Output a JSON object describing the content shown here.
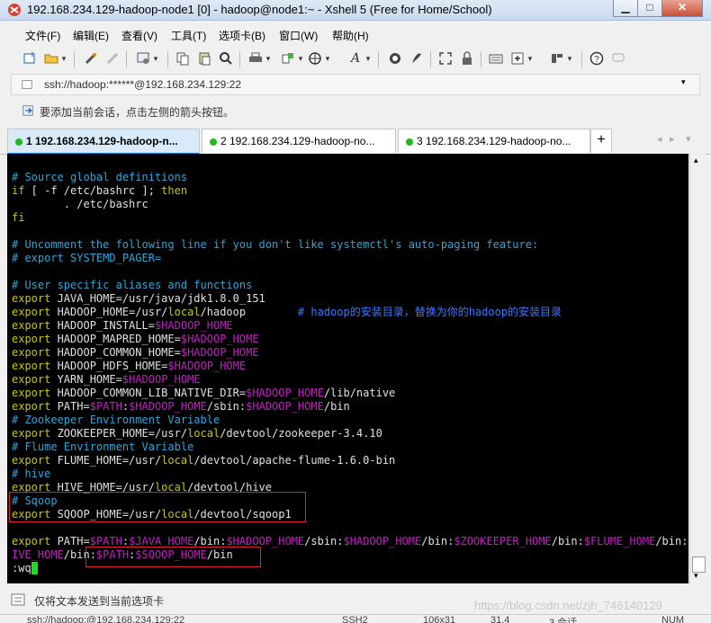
{
  "window": {
    "title": "192.168.234.129-hadoop-node1 [0] - hadoop@node1:~ - Xshell 5 (Free for Home/School)"
  },
  "menu": [
    "文件(F)",
    "编辑(E)",
    "查看(V)",
    "工具(T)",
    "选项卡(B)",
    "窗口(W)",
    "帮助(H)"
  ],
  "address": {
    "value": "ssh://hadoop:******@192.168.234.129:22"
  },
  "hint": {
    "text": "要添加当前会话，点击左侧的箭头按钮。"
  },
  "tabs": [
    {
      "num": "1",
      "label": "192.168.234.129-hadoop-node1",
      "display": "1 192.168.234.129-hadoop-n..."
    },
    {
      "num": "2",
      "display": "2 192.168.234.129-hadoop-no..."
    },
    {
      "num": "3",
      "display": "3 192.168.234.129-hadoop-no..."
    }
  ],
  "terminal": {
    "lines": [
      [
        [
          "# Source global definitions",
          "c"
        ]
      ],
      [
        [
          "if",
          "y"
        ],
        [
          " [ -f /etc/bashrc ]; ",
          "w"
        ],
        [
          "then",
          "y"
        ]
      ],
      [
        [
          "        . /etc/bashrc",
          "w"
        ]
      ],
      [
        [
          "fi",
          "y"
        ]
      ],
      [],
      [
        [
          "# Uncomment the following line if you don't like systemctl's auto-paging feature:",
          "c"
        ]
      ],
      [
        [
          "# export SYSTEMD_PAGER=",
          "c"
        ]
      ],
      [],
      [
        [
          "# User specific aliases and functions",
          "c"
        ]
      ],
      [
        [
          "export",
          "y"
        ],
        [
          " JAVA_HOME=/usr/java/jdk1.8.0_151",
          "w"
        ]
      ],
      [
        [
          "export",
          "y"
        ],
        [
          " HADOOP_HOME=/usr/",
          "w"
        ],
        [
          "local",
          "y"
        ],
        [
          "/hadoop        ",
          "w"
        ],
        [
          "# hadoop的安装目录，替换为你的hadoop的安装目录",
          "b"
        ]
      ],
      [
        [
          "export",
          "y"
        ],
        [
          " HADOOP_INSTALL=",
          "w"
        ],
        [
          "$HADOOP_HOME",
          "m"
        ]
      ],
      [
        [
          "export",
          "y"
        ],
        [
          " HADOOP_MAPRED_HOME=",
          "w"
        ],
        [
          "$HADOOP_HOME",
          "m"
        ]
      ],
      [
        [
          "export",
          "y"
        ],
        [
          " HADOOP_COMMON_HOME=",
          "w"
        ],
        [
          "$HADOOP_HOME",
          "m"
        ]
      ],
      [
        [
          "export",
          "y"
        ],
        [
          " HADOOP_HDFS_HOME=",
          "w"
        ],
        [
          "$HADOOP_HOME",
          "m"
        ]
      ],
      [
        [
          "export",
          "y"
        ],
        [
          " YARN_HOME=",
          "w"
        ],
        [
          "$HADOOP_HOME",
          "m"
        ]
      ],
      [
        [
          "export",
          "y"
        ],
        [
          " HADOOP_COMMON_LIB_NATIVE_DIR=",
          "w"
        ],
        [
          "$HADOOP_HOME",
          "m"
        ],
        [
          "/lib/native",
          "w"
        ]
      ],
      [
        [
          "export",
          "y"
        ],
        [
          " PATH=",
          "w"
        ],
        [
          "$PATH",
          "m"
        ],
        [
          ":",
          "w"
        ],
        [
          "$HADOOP_HOME",
          "m"
        ],
        [
          "/sbin:",
          "w"
        ],
        [
          "$HADOOP_HOME",
          "m"
        ],
        [
          "/bin",
          "w"
        ]
      ],
      [
        [
          "# Zookeeper Environment Variable",
          "c"
        ]
      ],
      [
        [
          "export",
          "y"
        ],
        [
          " ZOOKEEPER_HOME=/usr/",
          "w"
        ],
        [
          "local",
          "y"
        ],
        [
          "/devtool/zookeeper-3.4.10",
          "w"
        ]
      ],
      [
        [
          "# Flume Environment Variable",
          "c"
        ]
      ],
      [
        [
          "export",
          "y"
        ],
        [
          " FLUME_HOME=/usr/",
          "w"
        ],
        [
          "local",
          "y"
        ],
        [
          "/devtool/apache-flume-1.6.0-bin",
          "w"
        ]
      ],
      [
        [
          "# hive",
          "c"
        ]
      ],
      [
        [
          "export",
          "y"
        ],
        [
          " HIVE_HOME=/usr/",
          "w"
        ],
        [
          "local",
          "y"
        ],
        [
          "/devtool/hive",
          "w"
        ]
      ],
      [
        [
          "# Sqoop",
          "c"
        ]
      ],
      [
        [
          "export",
          "y"
        ],
        [
          " SQOOP_HOME=/usr/",
          "w"
        ],
        [
          "local",
          "y"
        ],
        [
          "/devtool/sqoop1",
          "w"
        ]
      ],
      [],
      [
        [
          "export",
          "y"
        ],
        [
          " PATH=",
          "w"
        ],
        [
          "$PATH",
          "m"
        ],
        [
          ":",
          "w"
        ],
        [
          "$JAVA_HOME",
          "m"
        ],
        [
          "/bin:",
          "w"
        ],
        [
          "$HADOOP_HOME",
          "m"
        ],
        [
          "/sbin:",
          "w"
        ],
        [
          "$HADOOP_HOME",
          "m"
        ],
        [
          "/bin:",
          "w"
        ],
        [
          "$ZOOKEEPER_HOME",
          "m"
        ],
        [
          "/bin:",
          "w"
        ],
        [
          "$FLUME_HOME",
          "m"
        ],
        [
          "/bin:",
          "w"
        ],
        [
          "$H",
          "m"
        ]
      ],
      [
        [
          "IVE_HOME",
          "m"
        ],
        [
          "/bin:",
          "w"
        ],
        [
          "$PATH",
          "m"
        ],
        [
          ":",
          "w"
        ],
        [
          "$SQOOP_HOME",
          "m"
        ],
        [
          "/bin",
          "w"
        ]
      ],
      [
        [
          ":wq",
          "w"
        ]
      ]
    ]
  },
  "sendbar": {
    "text": "仅将文本发送到当前选项卡"
  },
  "status": {
    "left": "ssh://hadoop:@192.168.234.129:22",
    "protocol": "SSH2",
    "size": "106x31",
    "pos": "31,4",
    "sessions": "3 会话",
    "num": "NUM"
  },
  "watermark": "https://blog.csdn.net/zjh_746140129",
  "colors": {
    "comment": "#2ea6d8",
    "keyword": "#c8c800",
    "variable": "#c020c0",
    "text": "#e0e0e0",
    "highlight_box": "#e0202a",
    "cursor": "#18e018",
    "active_tab": "#0e7ad6"
  }
}
